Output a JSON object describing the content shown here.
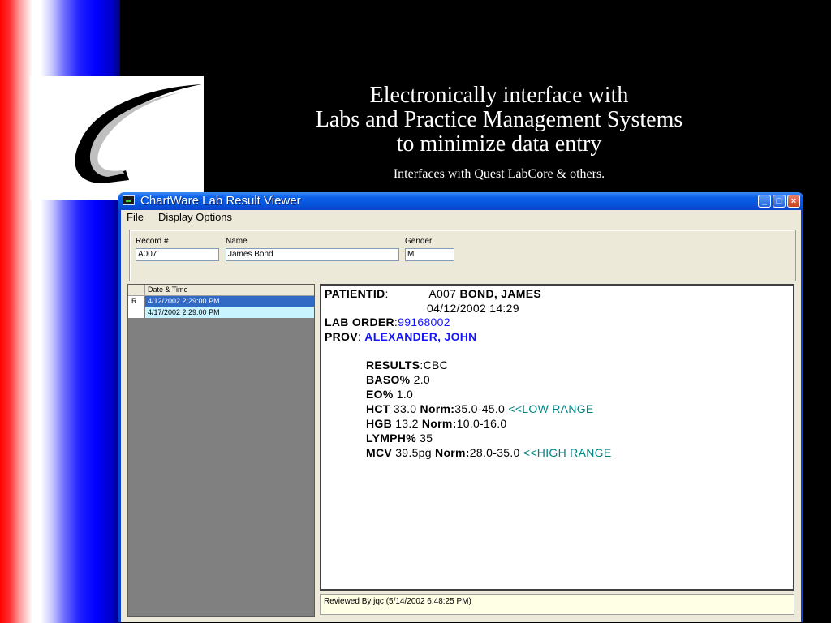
{
  "slide": {
    "title_line1": "Electronically interface with",
    "title_line2": "Labs and Practice Management Systems",
    "title_line3": "to minimize data entry",
    "subtitle": "Interfaces with Quest LabCore & others."
  },
  "window": {
    "title": "ChartWare Lab Result Viewer",
    "menu": [
      "File",
      "Display Options"
    ]
  },
  "patient_fields": {
    "record_label": "Record #",
    "record_value": "A007",
    "name_label": "Name",
    "name_value": "James  Bond",
    "gender_label": "Gender",
    "gender_value": "M"
  },
  "results_list": {
    "header": "Date & Time",
    "rows": [
      {
        "marker": "R",
        "datetime": "4/12/2002 2:29:00 PM"
      },
      {
        "marker": "",
        "datetime": "4/17/2002 2:29:00 PM"
      }
    ]
  },
  "report": {
    "patientid_label": "PATIENTID",
    "patientid_value": "A007",
    "patient_name": "BOND, JAMES",
    "order_datetime": "04/12/2002 14:29",
    "lab_order_label": "LAB ORDER",
    "lab_order_value": "99168002",
    "prov_label": "PROV",
    "prov_value": "ALEXANDER, JOHN",
    "results_label": "RESULTS",
    "results_value": "CBC",
    "tests": [
      {
        "name": "BASO%",
        "value": "2.0"
      },
      {
        "name": "EO%",
        "value": "1.0"
      },
      {
        "name": "HCT",
        "value": "33.0",
        "norm_label": "Norm:",
        "norm": "35.0-45.0",
        "flag": "<<LOW RANGE"
      },
      {
        "name": "HGB",
        "value": "13.2",
        "norm_label": "Norm:",
        "norm": "10.0-16.0"
      },
      {
        "name": "LYMPH%",
        "value": "35"
      },
      {
        "name": "MCV",
        "value": "39.5pg",
        "norm_label": "Norm:",
        "norm": "28.0-35.0",
        "flag": "<<HIGH RANGE"
      }
    ]
  },
  "status": {
    "reviewed": "Reviewed By jqc (5/14/2002 6:48:25 PM)"
  },
  "colors": {
    "link_blue": "#1414ff",
    "flag_teal": "#008080",
    "selected_row": "#316ac5",
    "highlight_row": "#c8f4ff"
  }
}
